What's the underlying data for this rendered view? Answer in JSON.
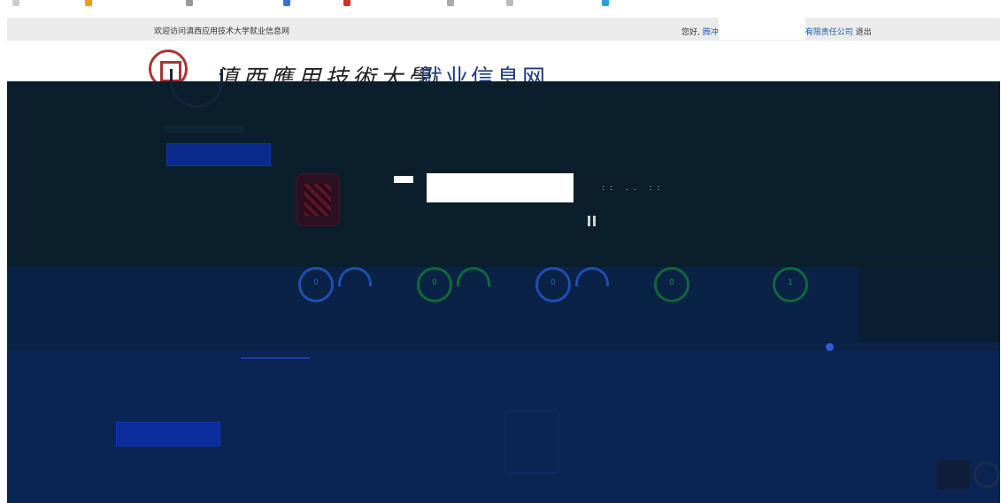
{
  "browser": {
    "bookmarks": [
      "",
      "",
      "",
      "",
      "",
      "",
      "",
      "",
      ""
    ]
  },
  "topbar": {
    "welcome": "欢迎访问滇西应用技术大学就业信息网",
    "greeting": "您好,",
    "user_prefix": "腾冲",
    "user_suffix": "有限责任公司",
    "logout": "退出"
  },
  "header": {
    "university_name": "滇西應用技術大學",
    "site_title": "就业信息网"
  },
  "overlay": {
    "stats": [
      {
        "value": "0",
        "color": "#1e4fb0"
      },
      {
        "value": "0",
        "color": "#10683a"
      },
      {
        "value": "0",
        "color": "#1e4fb0"
      },
      {
        "value": "0",
        "color": "#10683a"
      },
      {
        "value": "1",
        "color": "#10683a"
      }
    ]
  },
  "colors": {
    "overlay_dark": "#0b1e2b",
    "brand_blue": "#1c3a7a",
    "seal_red": "#aa3333"
  }
}
